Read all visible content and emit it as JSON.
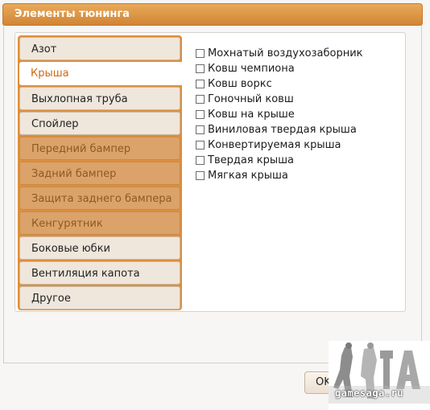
{
  "window": {
    "title": "Элементы тюнинга"
  },
  "tabs": [
    {
      "label": "Азот",
      "state": "normal"
    },
    {
      "label": "Крыша",
      "state": "selected"
    },
    {
      "label": "Выхлопная труба",
      "state": "normal"
    },
    {
      "label": "Спойлер",
      "state": "normal"
    },
    {
      "label": "Передний бампер",
      "state": "disabled"
    },
    {
      "label": "Задний бампер",
      "state": "disabled"
    },
    {
      "label": "Защита заднего бампера",
      "state": "disabled"
    },
    {
      "label": "Кенгурятник",
      "state": "disabled"
    },
    {
      "label": "Боковые юбки",
      "state": "normal"
    },
    {
      "label": "Вентиляция капота",
      "state": "normal"
    },
    {
      "label": "Другое",
      "state": "normal"
    }
  ],
  "options": [
    {
      "label": "Мохнатый воздухозаборник",
      "checked": false
    },
    {
      "label": "Ковш чемпиона",
      "checked": false
    },
    {
      "label": "Ковш воркс",
      "checked": false
    },
    {
      "label": "Гоночный ковш",
      "checked": false
    },
    {
      "label": "Ковш на крыше",
      "checked": false
    },
    {
      "label": "Виниловая твердая крыша",
      "checked": false
    },
    {
      "label": "Конвертируемая крыша",
      "checked": false
    },
    {
      "label": "Твердая крыша",
      "checked": false
    },
    {
      "label": "Мягкая крыша",
      "checked": false
    }
  ],
  "footer": {
    "ok_label": "OK"
  },
  "watermark": {
    "text": "gamesaga.ru",
    "logo": "GTA"
  },
  "colors": {
    "accent": "#d88a38",
    "selected_text": "#cc6a10"
  }
}
